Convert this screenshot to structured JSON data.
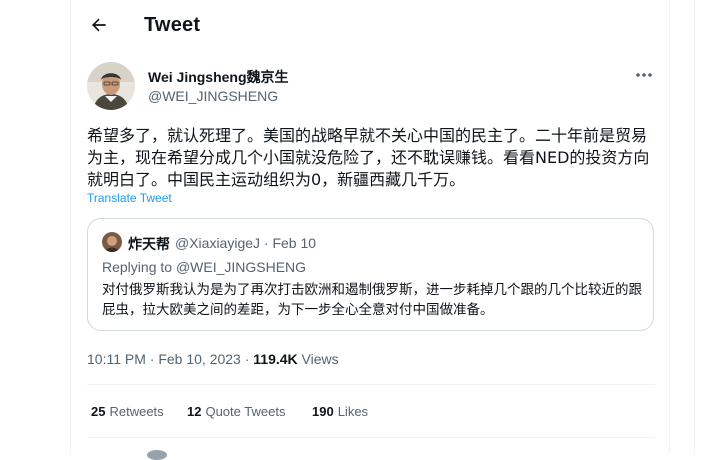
{
  "header": {
    "title": "Tweet"
  },
  "tweet": {
    "author": {
      "name": "Wei Jingsheng魏京生",
      "handle": "@WEI_JINGSHENG"
    },
    "text": "希望多了，就认死理了。美国的战略早就不关心中国的民主了。二十年前是贸易为主，现在希望分成几个小国就没危险了，还不耽误赚钱。看看NED的投资方向就明白了。中国民主运动组织为0，新疆西藏几千万。",
    "translate_label": "Translate Tweet",
    "quote": {
      "name": "炸天帮",
      "meta": "@XiaxiayigeJ · Feb 10",
      "replying_prefix": "Replying to ",
      "replying_handle": "@WEI_JINGSHENG",
      "text": "对付俄罗斯我认为是为了再次打击欧洲和遏制俄罗斯，进一步耗掉几个跟的几个比较近的跟屁虫，拉大欧美之间的差距，为下一步全心全意对付中国做准备。"
    },
    "timestamp": "10:11 PM · Feb 10, 2023 · ",
    "views_count": "119.4K",
    "views_label": " Views",
    "stats": [
      {
        "count": "25",
        "label": "Retweets"
      },
      {
        "count": "12",
        "label": "Quote Tweets"
      },
      {
        "count": "190",
        "label": "Likes"
      }
    ]
  },
  "icons": {
    "back": "arrow-left-icon",
    "more": "more-horizontal-icon"
  },
  "colors": {
    "link": "#1d9bf0",
    "secondary_text": "#536471",
    "border": "#cfd9de"
  }
}
